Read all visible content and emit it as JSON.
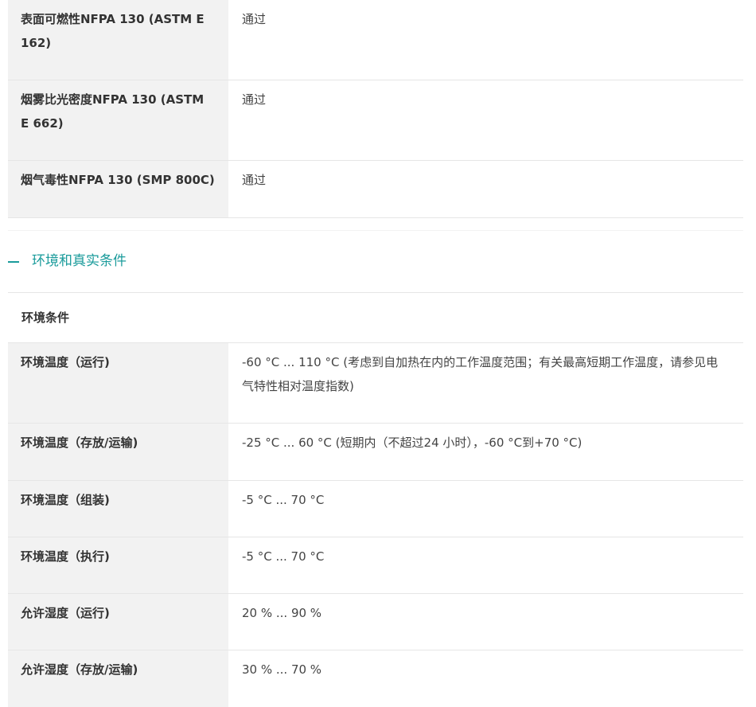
{
  "top_rows": [
    {
      "label": "表面可燃性NFPA 130 (ASTM E 162)",
      "value": "通过"
    },
    {
      "label": "烟雾比光密度NFPA 130 (ASTM E 662)",
      "value": "通过"
    },
    {
      "label": "烟气毒性NFPA 130 (SMP 800C)",
      "value": "通过"
    }
  ],
  "section": {
    "title": "环境和真实条件",
    "icon": "minus-icon",
    "accent_color": "#1a9b9b"
  },
  "subsection": {
    "title": "环境条件"
  },
  "env_rows": [
    {
      "label": "环境温度（运行)",
      "value": "-60 °C ... 110 °C (考虑到自加热在内的工作温度范围；有关最高短期工作温度，请参见电气特性相对温度指数)"
    },
    {
      "label": "环境温度（存放/运输)",
      "value": "-25 °C ... 60 °C (短期内（不超过24  小时），-60 °C到+70 °C)"
    },
    {
      "label": "环境温度（组装)",
      "value": "-5 °C ... 70 °C"
    },
    {
      "label": "环境温度（执行)",
      "value": "-5 °C ... 70 °C"
    },
    {
      "label": "允许湿度（运行)",
      "value": "20 % ... 90 %"
    },
    {
      "label": "允许湿度（存放/运输)",
      "value": "30 % ... 70 %"
    }
  ]
}
